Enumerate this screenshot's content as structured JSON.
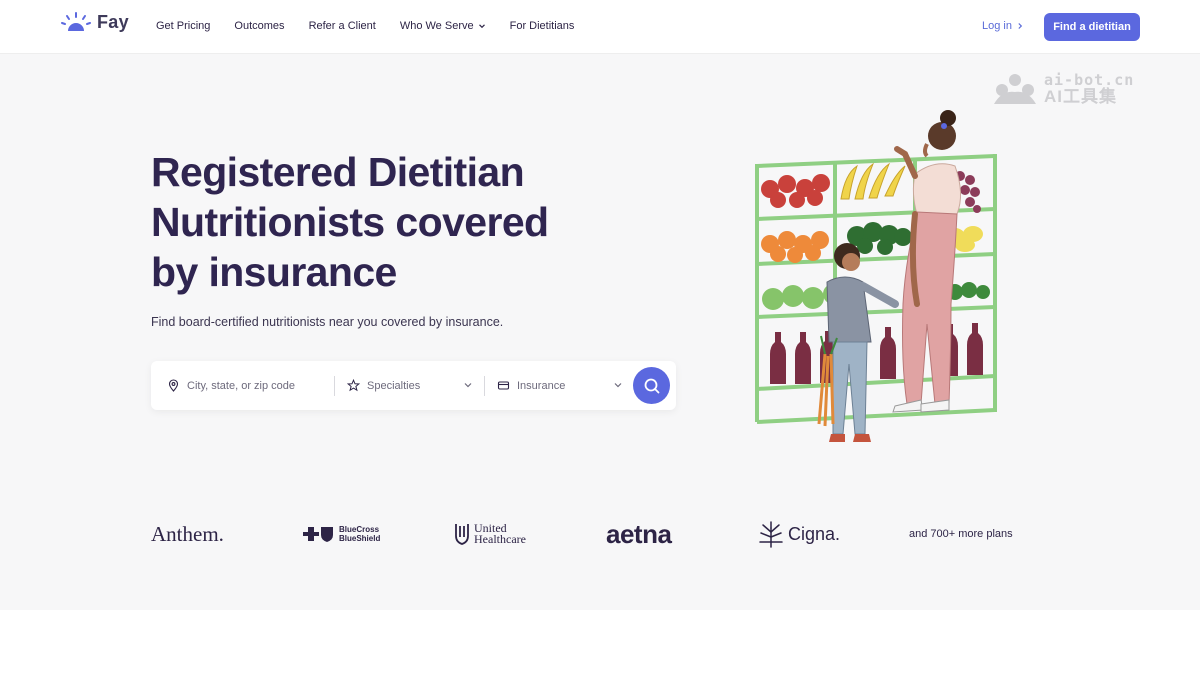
{
  "nav": {
    "logo_text": "Fay",
    "links": [
      {
        "label": "Get Pricing"
      },
      {
        "label": "Outcomes"
      },
      {
        "label": "Refer a Client"
      },
      {
        "label": "Who We Serve"
      },
      {
        "label": "For Dietitians"
      }
    ],
    "login_label": "Log in",
    "cta_label": "Find a dietitian"
  },
  "watermark": {
    "line1": "ai-bot.cn",
    "line2": "AI工具集"
  },
  "hero": {
    "headline": "Registered Dietitian Nutritionists covered by insurance",
    "subtitle": "Find board-certified nutritionists near you covered by insurance."
  },
  "search": {
    "location_placeholder": "City, state, or zip code",
    "specialties_label": "Specialties",
    "insurance_label": "Insurance"
  },
  "insurers": {
    "anthem": "Anthem.",
    "bcbs_line1": "BlueCross",
    "bcbs_line2": "BlueShield",
    "uhc_line1": "United",
    "uhc_line2": "Healthcare",
    "aetna": "aetna",
    "cigna": "Cigna.",
    "more": "and 700+ more plans"
  },
  "colors": {
    "accent": "#5b68df",
    "heading": "#2f2550",
    "hero_bg": "#f7f7f8"
  }
}
